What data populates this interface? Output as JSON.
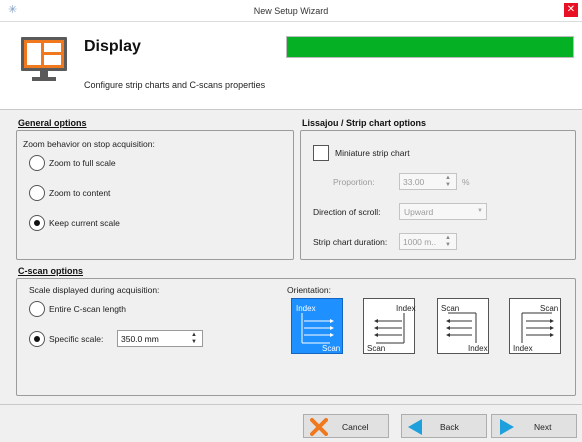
{
  "window": {
    "title": "New Setup Wizard",
    "close_glyph": "✕",
    "app_icon": "spark-icon"
  },
  "header": {
    "title": "Display",
    "subtitle": "Configure strip charts and C-scans properties",
    "progress_percent": 100,
    "progress_color": "#06b025"
  },
  "general_options": {
    "title": "General options",
    "zoom_label": "Zoom behavior on stop acquisition:",
    "options": [
      {
        "label": "Zoom to full scale",
        "checked": false
      },
      {
        "label": "Zoom to content",
        "checked": false
      },
      {
        "label": "Keep current scale",
        "checked": true
      }
    ]
  },
  "lissajou": {
    "title": "Lissajou / Strip chart options",
    "miniature_label": "Miniature strip chart",
    "miniature_checked": false,
    "proportion_label": "Proportion:",
    "proportion_value": "33.00",
    "proportion_unit": "%",
    "direction_label": "Direction of scroll:",
    "direction_value": "Upward",
    "duration_label": "Strip chart duration:",
    "duration_value": "1000 m.."
  },
  "cscan": {
    "title": "C-scan options",
    "scale_label": "Scale displayed during acquisition:",
    "entire_label": "Entire C-scan length",
    "entire_checked": false,
    "specific_label": "Specific scale:",
    "specific_checked": true,
    "specific_value": "350.0 mm",
    "orientation_label": "Orientation:",
    "orientations": [
      {
        "top": "Index",
        "bottom": "Scan",
        "selected": true
      },
      {
        "top": "Index",
        "bottom": "Scan",
        "selected": false
      },
      {
        "top": "Scan",
        "bottom": "Index",
        "selected": false
      },
      {
        "top": "Scan",
        "bottom": "Index",
        "selected": false
      }
    ]
  },
  "buttons": {
    "cancel": "Cancel",
    "back": "Back",
    "next": "Next"
  },
  "colors": {
    "accent": "#1e90ff",
    "monitor_orange": "#f0781e",
    "cancel_orange": "#f0781e",
    "arrow_blue": "#1ea0dc"
  }
}
